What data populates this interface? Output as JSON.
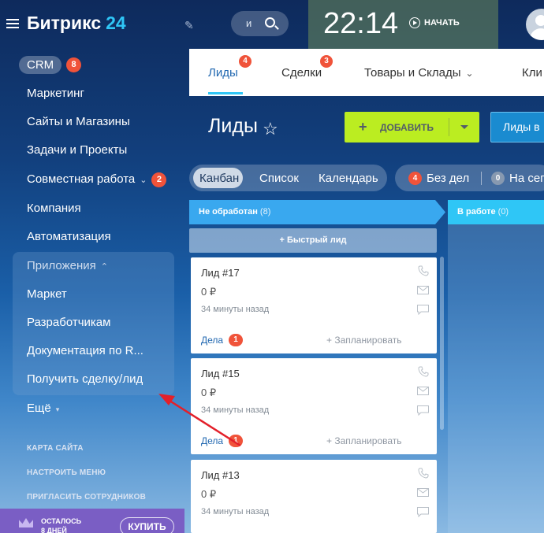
{
  "sidebar": {
    "logo_name": "Битрикс",
    "logo_number": "24",
    "crm_label": "CRM",
    "crm_badge": "8",
    "items": [
      {
        "label": "Маркетинг"
      },
      {
        "label": "Сайты и Магазины"
      },
      {
        "label": "Задачи и Проекты"
      },
      {
        "label": "Совместная работа",
        "badge": "2"
      },
      {
        "label": "Компания"
      },
      {
        "label": "Автоматизация"
      }
    ],
    "apps_title": "Приложения",
    "apps_items": [
      {
        "label": "Маркет"
      },
      {
        "label": "Разработчикам"
      },
      {
        "label": "Документация по R..."
      },
      {
        "label": "Получить сделку/лид"
      }
    ],
    "more_label": "Ещё",
    "small_links": [
      "КАРТА САЙТА",
      "НАСТРОИТЬ МЕНЮ",
      "ПРИГЛАСИТЬ СОТРУДНИКОВ"
    ],
    "trial_line1": "ОСТАЛОСЬ",
    "trial_line2": "8 ДНЕЙ",
    "buy_label": "КУПИТЬ"
  },
  "topbar": {
    "search_text": "и",
    "clock": "22:14",
    "start_label": "НАЧАТЬ"
  },
  "tabs": [
    {
      "label": "Лиды",
      "badge": "4"
    },
    {
      "label": "Сделки",
      "badge": "3"
    },
    {
      "label": "Товары и Склады"
    },
    {
      "label": "Кли"
    }
  ],
  "page": {
    "title": "Лиды",
    "add_label": "ДОБАВИТЬ",
    "leads_in_label": "Лиды в"
  },
  "views": [
    "Канбан",
    "Список",
    "Календарь"
  ],
  "filters": {
    "no_deals_badge": "4",
    "no_deals_label": "Без дел",
    "today_badge": "0",
    "today_label": "На сего"
  },
  "columns": [
    {
      "title": "Не обработан",
      "count": "(8)"
    },
    {
      "title": "В работе",
      "count": "(0)"
    }
  ],
  "quick_lead_label": "Быстрый лид",
  "cards": [
    {
      "title": "Лид #17",
      "price": "0 ₽",
      "time": "34 минуты назад",
      "deals_label": "Дела",
      "deals_badge": "1",
      "plan_label": "+ Запланировать"
    },
    {
      "title": "Лид #15",
      "price": "0 ₽",
      "time": "34 минуты назад",
      "deals_label": "Дела",
      "deals_badge": "1",
      "plan_label": "+ Запланировать"
    },
    {
      "title": "Лид #13",
      "price": "0 ₽",
      "time": "34 минуты назад"
    }
  ],
  "colors": {
    "accent_blue": "#2fc6f6",
    "badge_red": "#f0533a",
    "add_button": "#bbed21",
    "annotation_arrow": "#e3202a"
  }
}
